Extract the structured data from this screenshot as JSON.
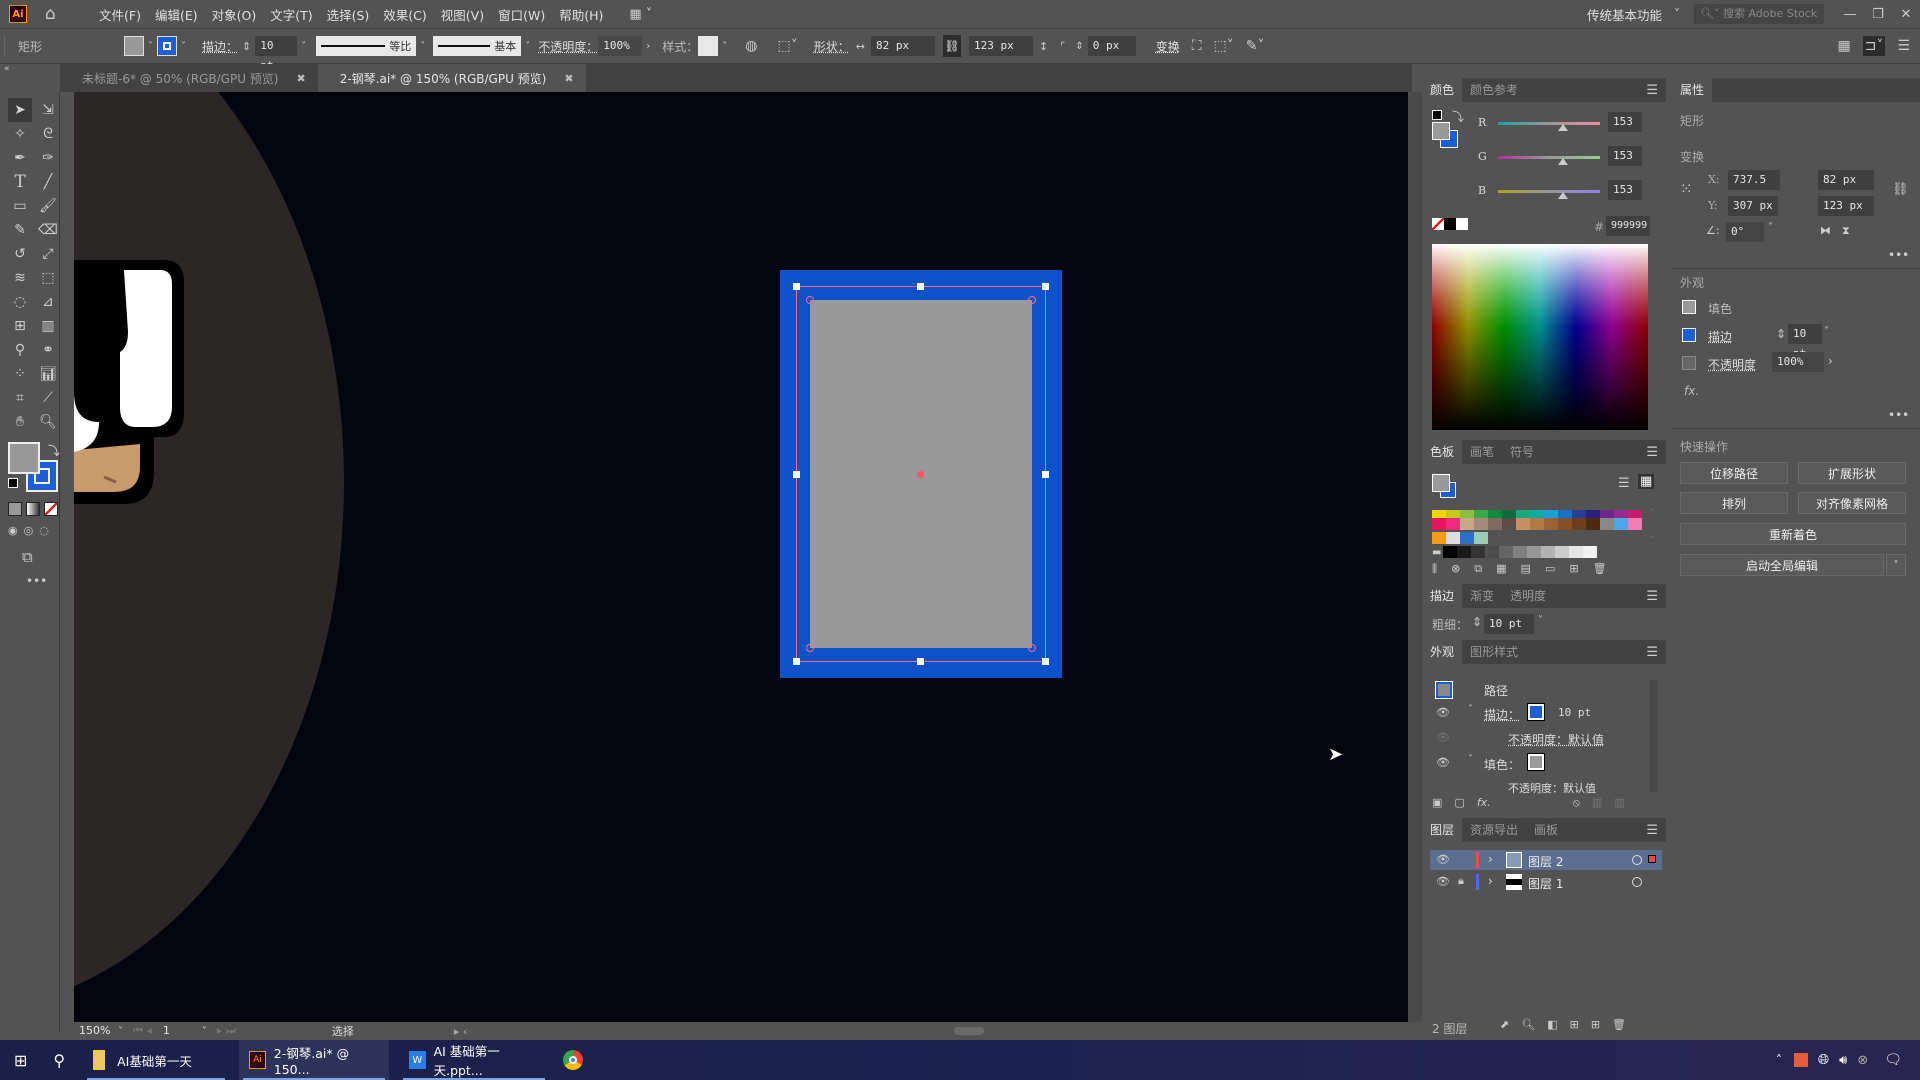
{
  "app": {
    "logo": "Ai",
    "menu": [
      "文件(F)",
      "编辑(E)",
      "对象(O)",
      "文字(T)",
      "选择(S)",
      "效果(C)",
      "视图(V)",
      "窗口(W)",
      "帮助(H)"
    ],
    "workspace": "传统基本功能",
    "stock_search_placeholder": "搜索 Adobe Stock"
  },
  "control_bar": {
    "object_type": "矩形",
    "stroke_label": "描边：",
    "stroke_weight": "10 pt",
    "stroke_profile_label": "等比",
    "brush_label": "基本",
    "opacity_label": "不透明度：",
    "opacity_value": "100%",
    "style_label": "样式：",
    "shape_label": "形状：",
    "width": "82 px",
    "height": "123 px",
    "corner_radius": "0 px",
    "transform_label": "变换",
    "fill_color": "#999999",
    "stroke_color": "#1a5fd6"
  },
  "tabs": [
    {
      "label": "未标题-6* @ 50% (RGB/GPU 预览)",
      "active": false
    },
    {
      "label": "2-钢琴.ai* @ 150% (RGB/GPU 预览)",
      "active": true
    }
  ],
  "tools": [
    "selection",
    "direct-selection",
    "magic-wand",
    "lasso",
    "pen",
    "curvature",
    "type",
    "line",
    "rectangle",
    "paintbrush",
    "shaper",
    "eraser",
    "rotate",
    "scale",
    "warp",
    "free-transform",
    "shape-builder",
    "perspective",
    "mesh",
    "gradient",
    "eyedropper",
    "blend",
    "symbol-sprayer",
    "graph",
    "artboard",
    "slice",
    "hand",
    "zoom"
  ],
  "status": {
    "zoom": "150%",
    "artboard": "1",
    "tool": "选择"
  },
  "color_panel": {
    "tabs": [
      "颜色",
      "颜色参考"
    ],
    "r": "153",
    "g": "153",
    "b": "153",
    "hex_label": "#",
    "hex": "999999"
  },
  "swatches_panel": {
    "tabs": [
      "色板",
      "画笔",
      "符号"
    ],
    "row1": [
      "#f5d800",
      "#c8c818",
      "#8cbf3f",
      "#3aa845",
      "#0e8a3e",
      "#0b6b3a",
      "#17a87c",
      "#15a9a3",
      "#1ba0d8",
      "#1474c4",
      "#2e3a94",
      "#2a1f7a",
      "#6a2a8c",
      "#9a2a8c",
      "#c41e6a"
    ],
    "row2": [
      "#e2175c",
      "#ee2a7b",
      "#c8a68a",
      "#a58a78",
      "#806a60",
      "#5e4c46",
      "#c69062",
      "#b27a48",
      "#9c6436",
      "#84502a",
      "#6c3e1c",
      "#4e2a10",
      "#888888",
      "#4aa8e8",
      "#ef7fb0"
    ],
    "row3": [
      "#f79a1c",
      "#dddddd",
      "#2a6fc8",
      "#9acbb4"
    ],
    "row4": [
      "#000000",
      "#1a1a1a",
      "#333333",
      "#4d4d4d",
      "#666666",
      "#808080",
      "#999999",
      "#b3b3b3",
      "#cccccc",
      "#e6e6e6",
      "#f2f2f2"
    ]
  },
  "stroke_panel": {
    "tabs": [
      "描边",
      "渐变",
      "透明度"
    ],
    "weight_label": "粗细：",
    "weight": "10 pt"
  },
  "appearance_panel": {
    "tabs": [
      "外观",
      "图形样式"
    ],
    "object": "路径",
    "stroke_label": "描边：",
    "stroke_value": "10 pt",
    "opacity_label": "不透明度：默认值",
    "fill_label": "填色：",
    "fill_opacity_label": "不透明度：默认值"
  },
  "layers_panel": {
    "tabs": [
      "图层",
      "资源导出",
      "画板"
    ],
    "layers": [
      {
        "name": "图层 2",
        "color": "#e84d4d",
        "selected": true,
        "locked": false
      },
      {
        "name": "图层 1",
        "color": "#4d6de8",
        "selected": false,
        "locked": true
      }
    ],
    "count_label": "2 图层"
  },
  "properties_panel": {
    "tab": "属性",
    "object_type": "矩形",
    "transform_label": "变换",
    "x_label": "X:",
    "x": "737.5 px",
    "y_label": "Y:",
    "y": "307 px",
    "w": "82 px",
    "h": "123 px",
    "angle": "0°",
    "appearance_label": "外观",
    "fill_label": "填色",
    "stroke_label": "描边",
    "stroke_weight": "10 pt",
    "opacity_label": "不透明度",
    "opacity": "100%",
    "fx_label": "fx.",
    "quick_actions_label": "快速操作",
    "btn_offset_path": "位移路径",
    "btn_expand_shape": "扩展形状",
    "btn_arrange": "排列",
    "btn_align_pixel": "对齐像素网格",
    "btn_recolor": "重新着色",
    "btn_global_edit": "启动全局编辑"
  },
  "taskbar": {
    "apps": [
      {
        "label": "AI基础第一天",
        "icon": "folder-icon"
      },
      {
        "label": "2-钢琴.ai* @ 150...",
        "icon": "illustrator-icon"
      },
      {
        "label": "AI 基础第一天.ppt...",
        "icon": "wps-icon"
      },
      {
        "label": "",
        "icon": "chrome-icon"
      }
    ]
  }
}
